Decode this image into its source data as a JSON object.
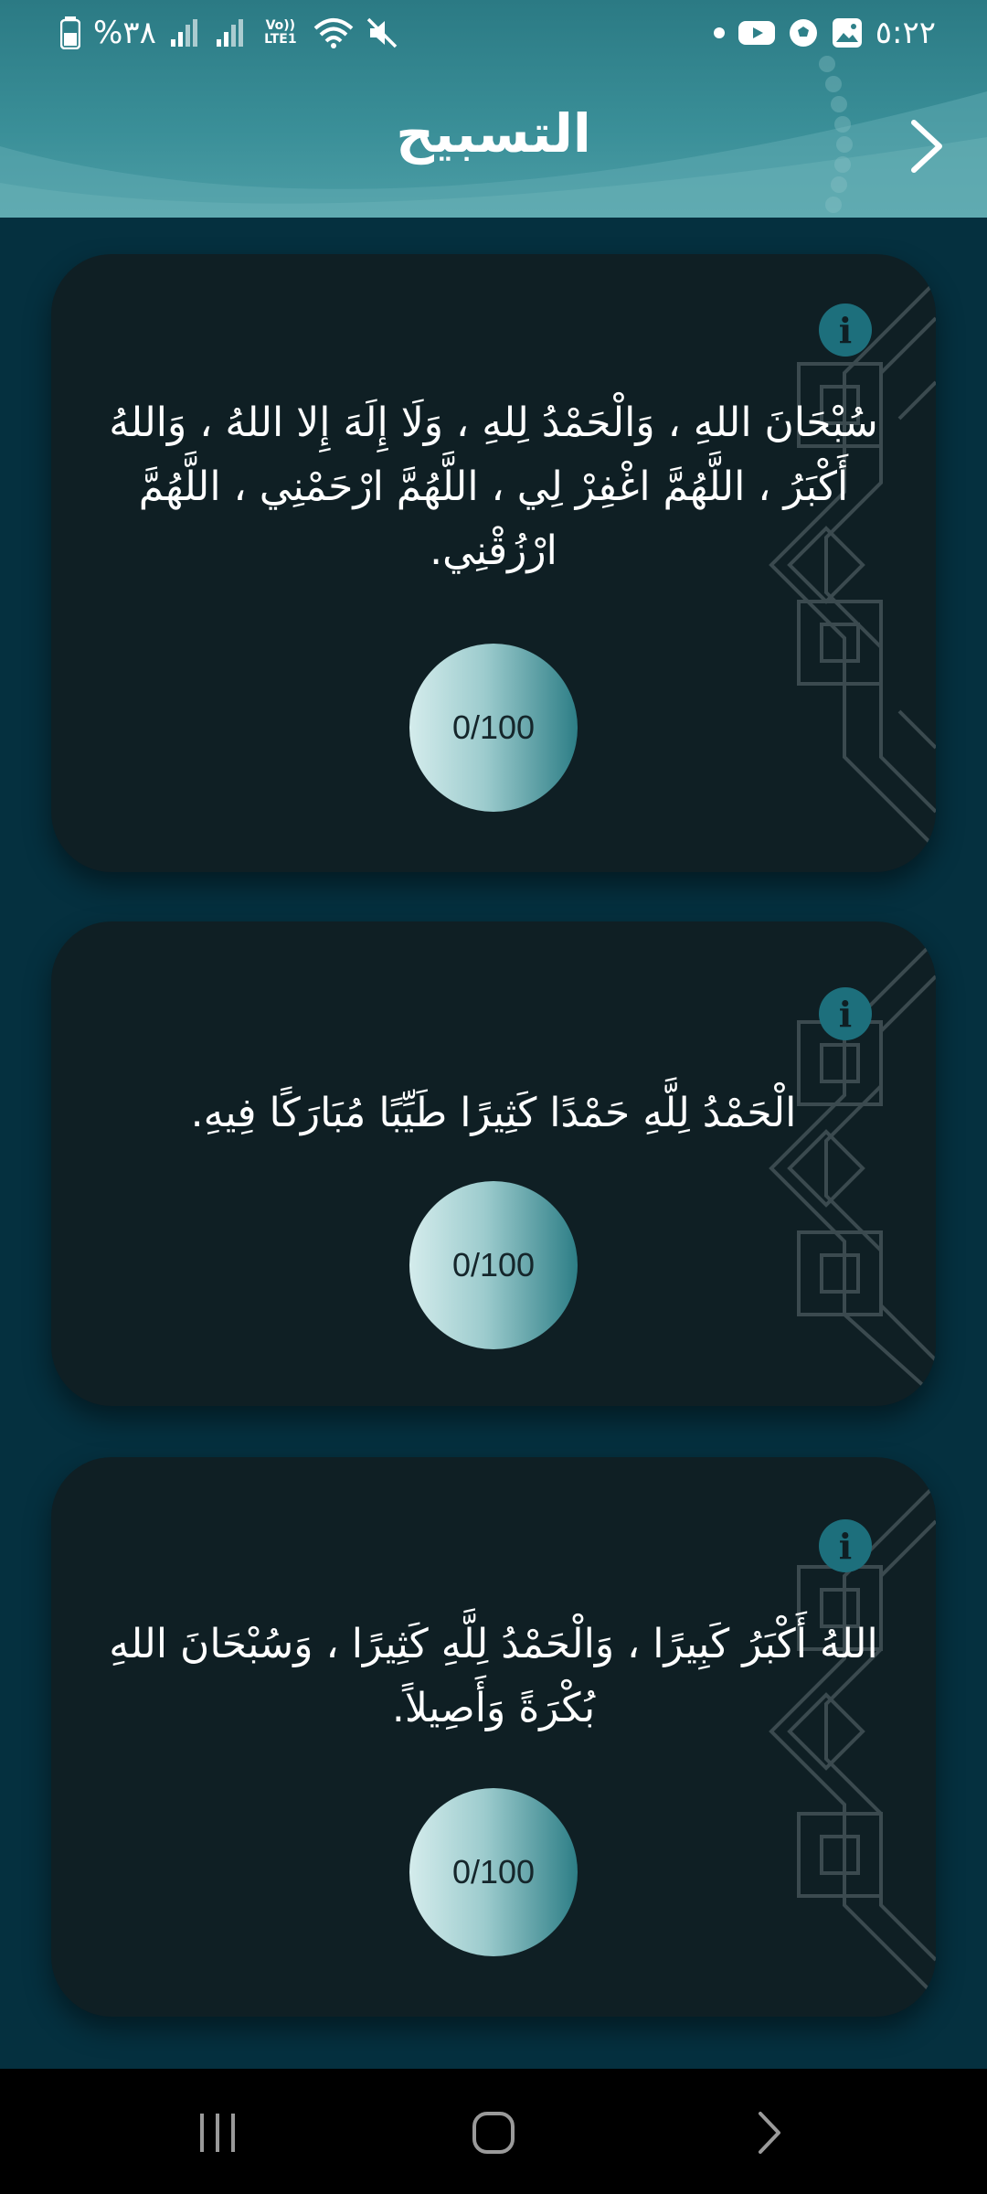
{
  "status_bar": {
    "battery_text": "%٣٨",
    "network_label": "Vo)) LTE1",
    "time": "٥:٢٢"
  },
  "header": {
    "title": "التسبيح",
    "back_icon": "chevron-right-icon"
  },
  "cards": [
    {
      "text": "سُبْحَانَ اللهِ ، وَالْحَمْدُ لِلهِ ، وَلَا إِلَهَ إِلا اللهُ ، وَاللهُ أَكْبَرُ ، اللَّهُمَّ اغْفِرْ لِي ، اللَّهُمَّ ارْحَمْنِي ، اللَّهُمَّ ارْزُقْنِي.",
      "counter": "0/100",
      "count": 0,
      "target": 100,
      "info_label": "i"
    },
    {
      "text": "الْحَمْدُ لِلَّهِ حَمْدًا كَثِيرًا طَيِّبًا مُبَارَكًا فِيهِ.",
      "counter": "0/100",
      "count": 0,
      "target": 100,
      "info_label": "i"
    },
    {
      "text": "اللهُ أَكْبَرُ كَبِيرًا ، وَالْحَمْدُ لِلَّهِ كَثِيرًا ، وَسُبْحَانَ اللهِ بُكْرَةً وَأَصِيلاً.",
      "counter": "0/100",
      "count": 0,
      "target": 100,
      "info_label": "i"
    }
  ],
  "colors": {
    "background": "#05303f",
    "card": "#0f1f24",
    "header": "#3a8f98",
    "accent": "#1d6f7c"
  }
}
